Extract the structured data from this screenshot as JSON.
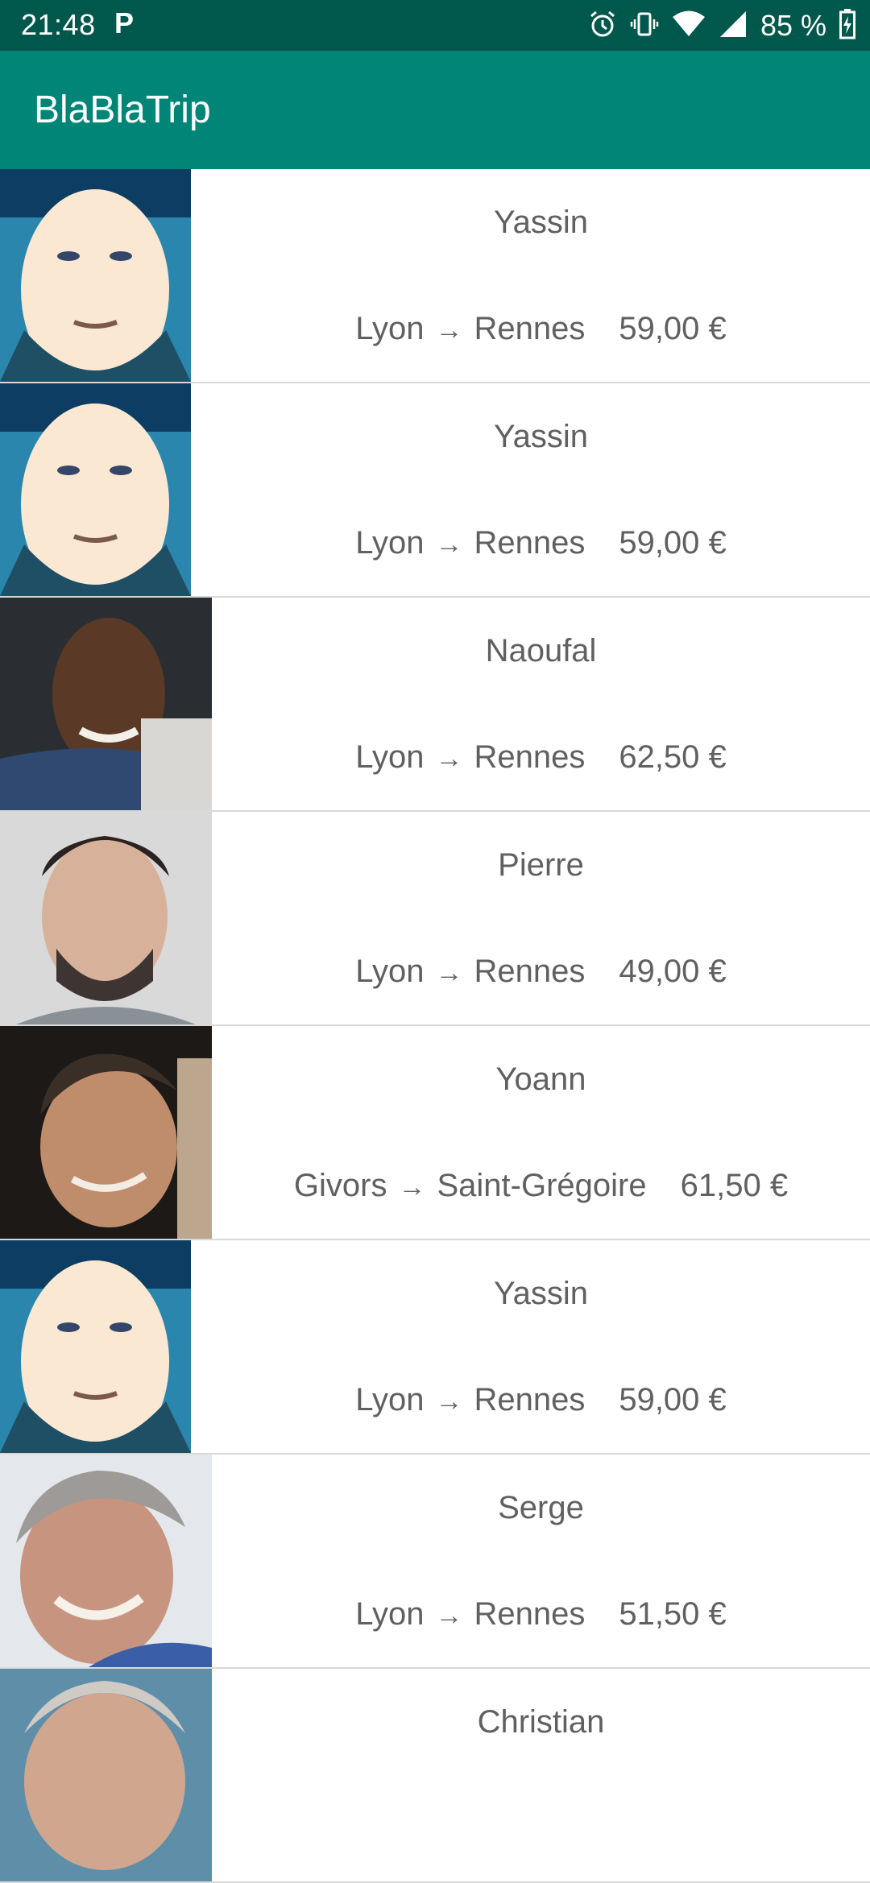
{
  "status": {
    "time": "21:48",
    "battery": "85 %"
  },
  "app": {
    "title": "BlaBlaTrip"
  },
  "trips": [
    {
      "name": "Yassin",
      "from": "Lyon",
      "arrow": "→",
      "to": "Rennes",
      "price": "59,00 €"
    },
    {
      "name": "Yassin",
      "from": "Lyon",
      "arrow": "→",
      "to": "Rennes",
      "price": "59,00 €"
    },
    {
      "name": "Naoufal",
      "from": "Lyon",
      "arrow": "→",
      "to": "Rennes",
      "price": "62,50 €"
    },
    {
      "name": "Pierre",
      "from": "Lyon",
      "arrow": "→",
      "to": "Rennes",
      "price": "49,00 €"
    },
    {
      "name": "Yoann",
      "from": "Givors",
      "arrow": "→",
      "to": "Saint-Grégoire",
      "price": "61,50 €"
    },
    {
      "name": "Yassin",
      "from": "Lyon",
      "arrow": "→",
      "to": "Rennes",
      "price": "59,00 €"
    },
    {
      "name": "Serge",
      "from": "Lyon",
      "arrow": "→",
      "to": "Rennes",
      "price": "51,50 €"
    },
    {
      "name": "Christian",
      "from": "",
      "arrow": "",
      "to": "",
      "price": ""
    }
  ]
}
